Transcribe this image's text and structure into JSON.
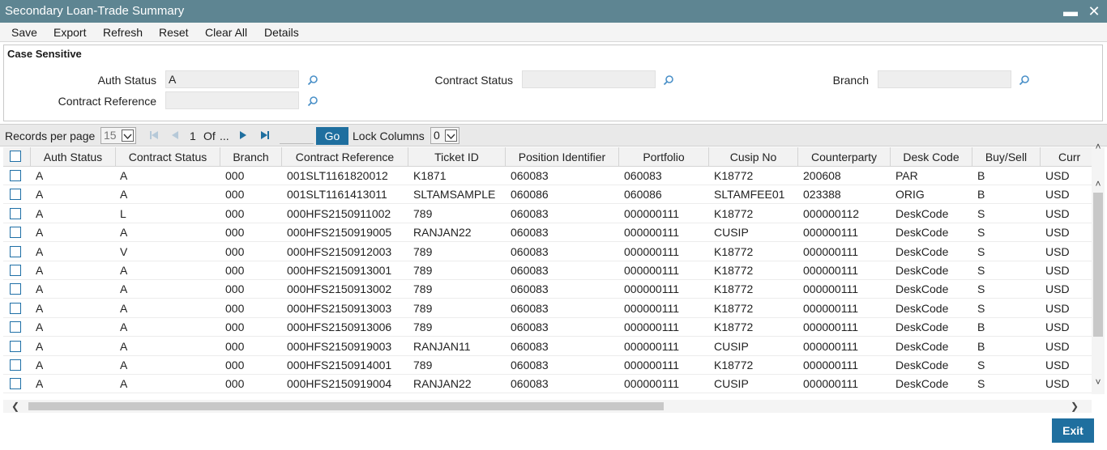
{
  "window": {
    "title": "Secondary Loan-Trade Summary"
  },
  "menu": [
    "Save",
    "Export",
    "Refresh",
    "Reset",
    "Clear All",
    "Details"
  ],
  "criteria": {
    "case_sensitive_label": "Case Sensitive",
    "auth_status_label": "Auth Status",
    "auth_status_value": "A",
    "contract_status_label": "Contract Status",
    "contract_status_value": "",
    "branch_label": "Branch",
    "branch_value": "",
    "contract_reference_label": "Contract Reference",
    "contract_reference_value": ""
  },
  "pager": {
    "records_per_page_label": "Records per page",
    "records_per_page_value": "15",
    "current_page": "1",
    "of_label": "Of",
    "total_pages": "...",
    "go_label": "Go",
    "lock_columns_label": "Lock Columns",
    "lock_columns_value": "0"
  },
  "table": {
    "columns": [
      "Auth Status",
      "Contract Status",
      "Branch",
      "Contract Reference",
      "Ticket ID",
      "Position Identifier",
      "Portfolio",
      "Cusip No",
      "Counterparty",
      "Desk Code",
      "Buy/Sell",
      "Curr"
    ],
    "rows": [
      [
        "A",
        "A",
        "000",
        "001SLT1161820012",
        "K1871",
        "060083",
        "060083",
        "K18772",
        "200608",
        "PAR",
        "B",
        "USD"
      ],
      [
        "A",
        "A",
        "000",
        "001SLT1161413011",
        "SLTAMSAMPLE",
        "060086",
        "060086",
        "SLTAMFEE01",
        "023388",
        "ORIG",
        "B",
        "USD"
      ],
      [
        "A",
        "L",
        "000",
        "000HFS2150911002",
        "789",
        "060083",
        "000000111",
        "K18772",
        "000000112",
        "DeskCode",
        "S",
        "USD"
      ],
      [
        "A",
        "A",
        "000",
        "000HFS2150919005",
        "RANJAN22",
        "060083",
        "000000111",
        "CUSIP",
        "000000111",
        "DeskCode",
        "S",
        "USD"
      ],
      [
        "A",
        "V",
        "000",
        "000HFS2150912003",
        "789",
        "060083",
        "000000111",
        "K18772",
        "000000111",
        "DeskCode",
        "S",
        "USD"
      ],
      [
        "A",
        "A",
        "000",
        "000HFS2150913001",
        "789",
        "060083",
        "000000111",
        "K18772",
        "000000111",
        "DeskCode",
        "S",
        "USD"
      ],
      [
        "A",
        "A",
        "000",
        "000HFS2150913002",
        "789",
        "060083",
        "000000111",
        "K18772",
        "000000111",
        "DeskCode",
        "S",
        "USD"
      ],
      [
        "A",
        "A",
        "000",
        "000HFS2150913003",
        "789",
        "060083",
        "000000111",
        "K18772",
        "000000111",
        "DeskCode",
        "S",
        "USD"
      ],
      [
        "A",
        "A",
        "000",
        "000HFS2150913006",
        "789",
        "060083",
        "000000111",
        "K18772",
        "000000111",
        "DeskCode",
        "B",
        "USD"
      ],
      [
        "A",
        "A",
        "000",
        "000HFS2150919003",
        "RANJAN11",
        "060083",
        "000000111",
        "CUSIP",
        "000000111",
        "DeskCode",
        "B",
        "USD"
      ],
      [
        "A",
        "A",
        "000",
        "000HFS2150914001",
        "789",
        "060083",
        "000000111",
        "K18772",
        "000000111",
        "DeskCode",
        "S",
        "USD"
      ],
      [
        "A",
        "A",
        "000",
        "000HFS2150919004",
        "RANJAN22",
        "060083",
        "000000111",
        "CUSIP",
        "000000111",
        "DeskCode",
        "S",
        "USD"
      ]
    ]
  },
  "footer": {
    "exit_label": "Exit"
  },
  "colors": {
    "titlebar": "#5e8592",
    "accent": "#1f6f9f",
    "checkbox": "#1e6fa6"
  }
}
